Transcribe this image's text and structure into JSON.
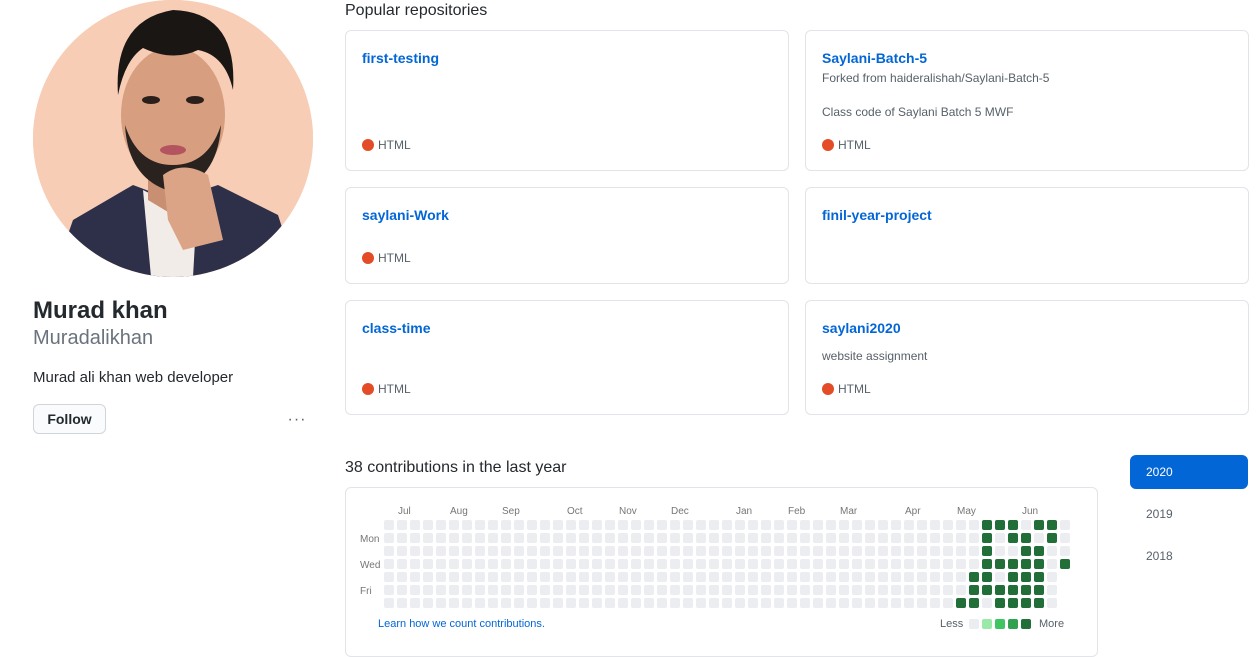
{
  "profile": {
    "fullname": "Murad khan",
    "username": "Muradalikhan",
    "bio": "Murad ali khan web developer",
    "follow_label": "Follow",
    "more_label": "···"
  },
  "pinned": {
    "title": "Popular repositories",
    "repos": [
      {
        "name": "first-testing",
        "fork": "",
        "description": "",
        "language": "HTML",
        "lang_color": "#e34c26"
      },
      {
        "name": "Saylani-Batch-5",
        "fork": "Forked from haideralishah/Saylani-Batch-5",
        "description": "Class code of Saylani Batch 5 MWF",
        "language": "HTML",
        "lang_color": "#e34c26"
      },
      {
        "name": "saylani-Work",
        "fork": "",
        "description": "",
        "language": "HTML",
        "lang_color": "#e34c26"
      },
      {
        "name": "finil-year-project",
        "fork": "",
        "description": "",
        "language": "",
        "lang_color": "#e34c26"
      },
      {
        "name": "class-time",
        "fork": "",
        "description": "",
        "language": "HTML",
        "lang_color": "#e34c26"
      },
      {
        "name": "saylani2020",
        "fork": "",
        "description": "website assignment",
        "language": "HTML",
        "lang_color": "#e34c26"
      }
    ]
  },
  "contributions": {
    "title": "38 contributions in the last year",
    "months": [
      "Jul",
      "Aug",
      "Sep",
      "Oct",
      "Nov",
      "Dec",
      "Jan",
      "Feb",
      "Mar",
      "Apr",
      "May",
      "Jun"
    ],
    "days": [
      "Mon",
      "Wed",
      "Fri"
    ],
    "learn_link": "Learn how we count contributions.",
    "legend_less": "Less",
    "legend_more": "More",
    "legend_colors": [
      "#ebedf0",
      "#9be9a8",
      "#40c463",
      "#30a14e",
      "#216e39"
    ],
    "empty_color": "#ebedf0",
    "active_color": "#216e39",
    "active_cells": [
      [
        46,
        1
      ],
      [
        47,
        1
      ],
      [
        48,
        1
      ],
      [
        50,
        1
      ],
      [
        51,
        1
      ],
      [
        46,
        2
      ],
      [
        48,
        2
      ],
      [
        49,
        2
      ],
      [
        51,
        2
      ],
      [
        46,
        3
      ],
      [
        49,
        3
      ],
      [
        50,
        3
      ],
      [
        46,
        4
      ],
      [
        47,
        4
      ],
      [
        48,
        4
      ],
      [
        49,
        4
      ],
      [
        50,
        4
      ],
      [
        52,
        4
      ],
      [
        45,
        5
      ],
      [
        46,
        5
      ],
      [
        48,
        5
      ],
      [
        49,
        5
      ],
      [
        50,
        5
      ],
      [
        45,
        6
      ],
      [
        46,
        6
      ],
      [
        47,
        6
      ],
      [
        48,
        6
      ],
      [
        49,
        6
      ],
      [
        50,
        6
      ],
      [
        44,
        7
      ],
      [
        45,
        7
      ],
      [
        47,
        7
      ],
      [
        48,
        7
      ],
      [
        49,
        7
      ],
      [
        50,
        7
      ]
    ]
  },
  "years": [
    "2020",
    "2019",
    "2018"
  ]
}
